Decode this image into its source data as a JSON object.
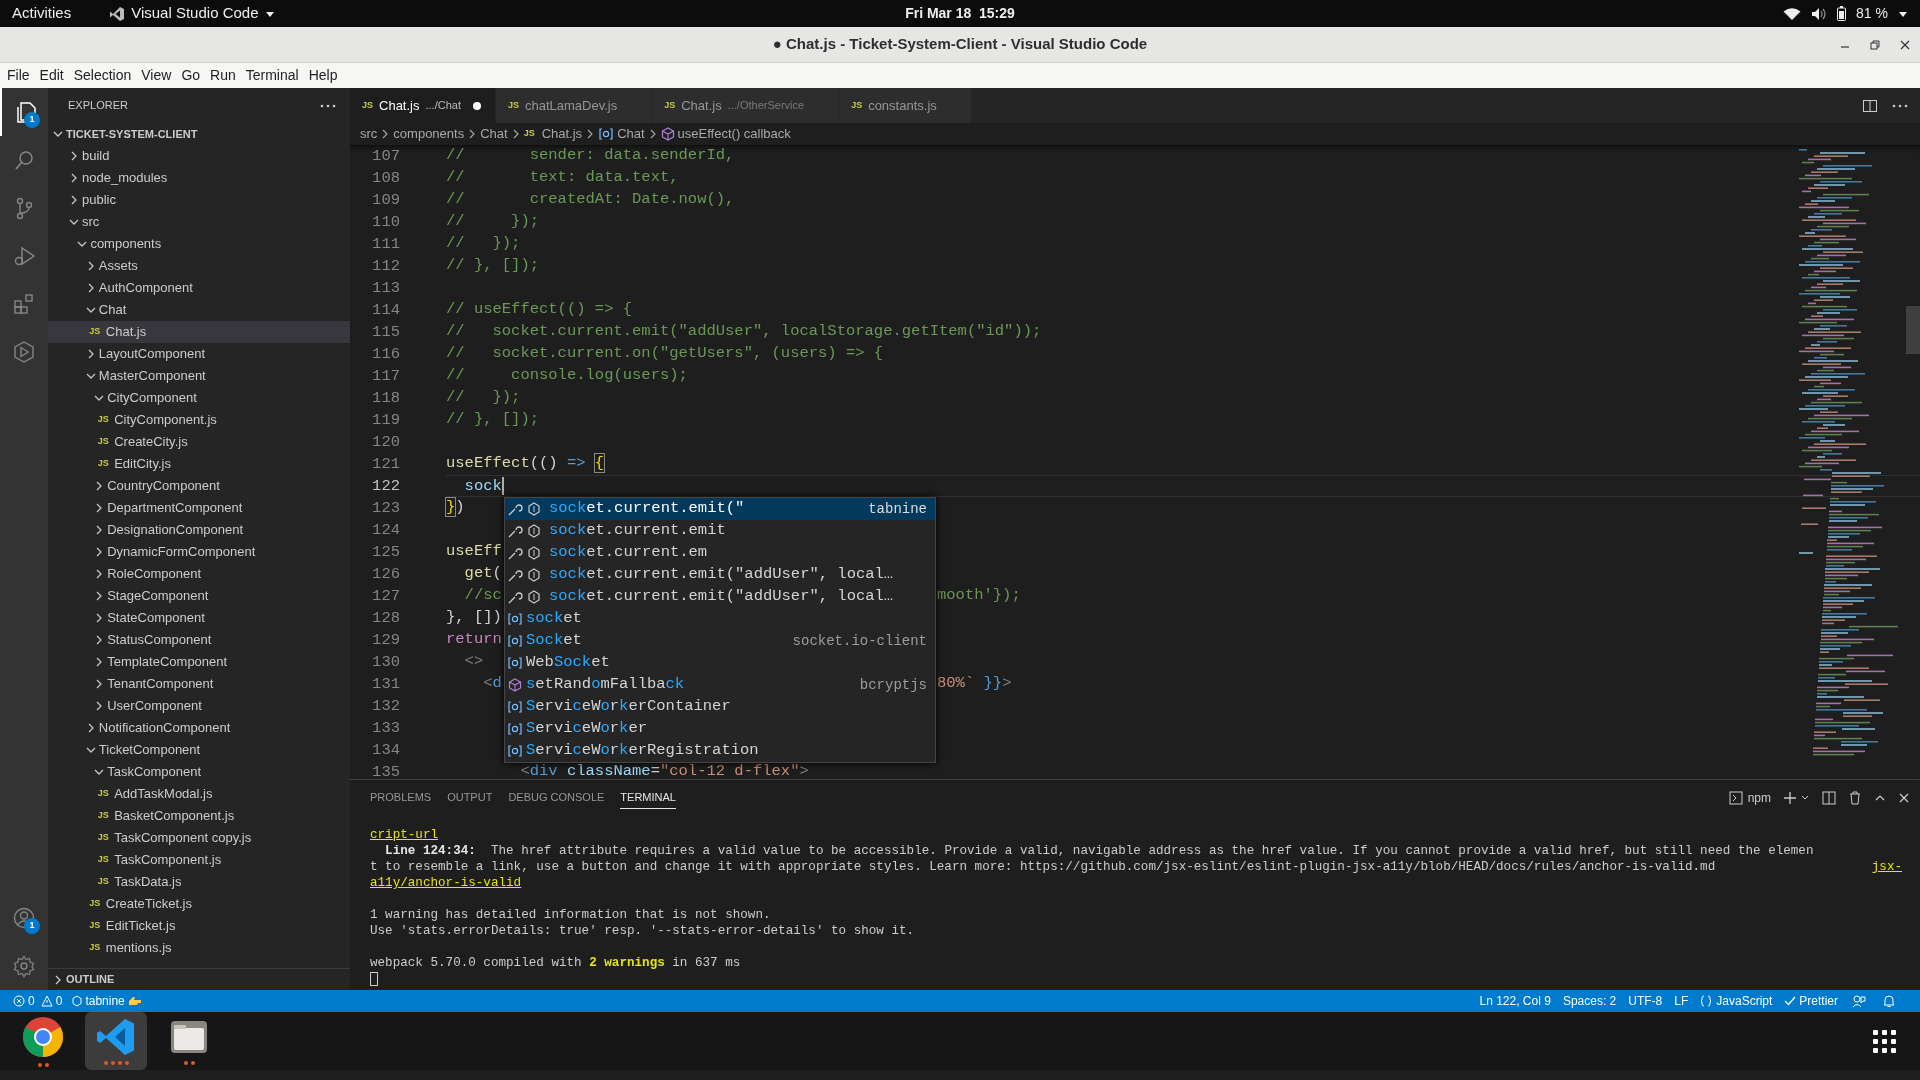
{
  "top_bar": {
    "activities": "Activities",
    "app": "Visual Studio Code",
    "clock": "Fri Mar 18  15:29",
    "battery": "81 %"
  },
  "window": {
    "title": "● Chat.js - Ticket-System-Client - Visual Studio Code"
  },
  "menu": [
    "File",
    "Edit",
    "Selection",
    "View",
    "Go",
    "Run",
    "Terminal",
    "Help"
  ],
  "activity_bar": [
    {
      "kind": "explorer",
      "selected": true,
      "badge": "1"
    },
    {
      "kind": "search",
      "selected": false
    },
    {
      "kind": "source-control",
      "selected": false
    },
    {
      "kind": "run-debug",
      "selected": false
    },
    {
      "kind": "extensions",
      "selected": false
    },
    {
      "kind": "hexagon",
      "selected": false
    }
  ],
  "activity_bottom": [
    {
      "kind": "accounts",
      "badge": "1"
    },
    {
      "kind": "settings"
    }
  ],
  "sidebar": {
    "title": "EXPLORER",
    "section": "TICKET-SYSTEM-CLIENT",
    "outline": "OUTLINE",
    "tree": [
      {
        "label": "build",
        "kind": "folder",
        "expanded": false,
        "selected": false
      },
      {
        "label": "node_modules",
        "kind": "folder",
        "expanded": false,
        "selected": false
      },
      {
        "label": "public",
        "kind": "folder",
        "expanded": false,
        "selected": false
      },
      {
        "label": "src",
        "kind": "folder",
        "expanded": true,
        "selected": false,
        "children": [
          {
            "label": "components",
            "kind": "folder",
            "expanded": true,
            "selected": false,
            "children": [
              {
                "label": "Assets",
                "kind": "folder",
                "expanded": false,
                "selected": false
              },
              {
                "label": "AuthComponent",
                "kind": "folder",
                "expanded": false,
                "selected": false
              },
              {
                "label": "Chat",
                "kind": "folder",
                "expanded": true,
                "selected": false,
                "children": [
                  {
                    "label": "Chat.js",
                    "kind": "file",
                    "badge": "JS",
                    "selected": true
                  }
                ]
              },
              {
                "label": "LayoutComponent",
                "kind": "folder",
                "expanded": false,
                "selected": false
              },
              {
                "label": "MasterComponent",
                "kind": "folder",
                "expanded": true,
                "selected": false,
                "children": [
                  {
                    "label": "CityComponent",
                    "kind": "folder",
                    "expanded": true,
                    "selected": false,
                    "children": [
                      {
                        "label": "CityComponent.js",
                        "kind": "file",
                        "badge": "JS",
                        "selected": false
                      },
                      {
                        "label": "CreateCity.js",
                        "kind": "file",
                        "badge": "JS",
                        "selected": false
                      },
                      {
                        "label": "EditCity.js",
                        "kind": "file",
                        "badge": "JS",
                        "selected": false
                      }
                    ]
                  },
                  {
                    "label": "CountryComponent",
                    "kind": "folder",
                    "expanded": false,
                    "selected": false
                  },
                  {
                    "label": "DepartmentComponent",
                    "kind": "folder",
                    "expanded": false,
                    "selected": false
                  },
                  {
                    "label": "DesignationComponent",
                    "kind": "folder",
                    "expanded": false,
                    "selected": false
                  },
                  {
                    "label": "DynamicFormComponent",
                    "kind": "folder",
                    "expanded": false,
                    "selected": false
                  },
                  {
                    "label": "RoleComponent",
                    "kind": "folder",
                    "expanded": false,
                    "selected": false
                  },
                  {
                    "label": "StageComponent",
                    "kind": "folder",
                    "expanded": false,
                    "selected": false
                  },
                  {
                    "label": "StateComponent",
                    "kind": "folder",
                    "expanded": false,
                    "selected": false
                  },
                  {
                    "label": "StatusComponent",
                    "kind": "folder",
                    "expanded": false,
                    "selected": false
                  },
                  {
                    "label": "TemplateComponent",
                    "kind": "folder",
                    "expanded": false,
                    "selected": false
                  },
                  {
                    "label": "TenantComponent",
                    "kind": "folder",
                    "expanded": false,
                    "selected": false
                  },
                  {
                    "label": "UserComponent",
                    "kind": "folder",
                    "expanded": false,
                    "selected": false
                  }
                ]
              },
              {
                "label": "NotificationComponent",
                "kind": "folder",
                "expanded": false,
                "selected": false
              },
              {
                "label": "TicketComponent",
                "kind": "folder",
                "expanded": true,
                "selected": false,
                "children": [
                  {
                    "label": "TaskComponent",
                    "kind": "folder",
                    "expanded": true,
                    "selected": false,
                    "children": [
                      {
                        "label": "AddTaskModal.js",
                        "kind": "file",
                        "badge": "JS",
                        "selected": false
                      },
                      {
                        "label": "BasketComponent.js",
                        "kind": "file",
                        "badge": "JS",
                        "selected": false
                      },
                      {
                        "label": "TaskComponent copy.js",
                        "kind": "file",
                        "badge": "JS",
                        "selected": false
                      },
                      {
                        "label": "TaskComponent.js",
                        "kind": "file",
                        "badge": "JS",
                        "selected": false
                      },
                      {
                        "label": "TaskData.js",
                        "kind": "file",
                        "badge": "JS",
                        "selected": false
                      }
                    ]
                  },
                  {
                    "label": "CreateTicket.js",
                    "kind": "file",
                    "badge": "JS",
                    "selected": false
                  },
                  {
                    "label": "EditTicket.js",
                    "kind": "file",
                    "badge": "JS",
                    "selected": false
                  },
                  {
                    "label": "mentions.js",
                    "kind": "file",
                    "badge": "JS",
                    "selected": false
                  }
                ]
              }
            ]
          }
        ]
      }
    ]
  },
  "tabs": [
    {
      "badge": "JS",
      "label": "Chat.js",
      "description": ".../Chat",
      "selected": true,
      "dirty": true
    },
    {
      "badge": "JS",
      "label": "chatLamaDev.js",
      "selected": false,
      "dirty": false
    },
    {
      "badge": "JS",
      "label": "Chat.js",
      "description": ".../OtherService",
      "selected": false,
      "dirty": false
    },
    {
      "badge": "JS",
      "label": "constants.js",
      "selected": false,
      "dirty": false
    }
  ],
  "breadcrumbs": [
    {
      "kind": "folder",
      "text": "src"
    },
    {
      "kind": "folder",
      "text": "components"
    },
    {
      "kind": "folder",
      "text": "Chat"
    },
    {
      "kind": "file",
      "badge": "JS",
      "text": "Chat.js"
    },
    {
      "kind": "variable",
      "text": "Chat"
    },
    {
      "kind": "method",
      "text": "useEffect() callback"
    }
  ],
  "code": [
    {
      "number": "107",
      "current": false,
      "tokens": [
        {
          "text": "//       sender: data.senderId,",
          "kind": "comment"
        }
      ]
    },
    {
      "number": "108",
      "current": false,
      "tokens": [
        {
          "text": "//       text: data.text,",
          "kind": "comment"
        }
      ]
    },
    {
      "number": "109",
      "current": false,
      "tokens": [
        {
          "text": "//       createdAt: Date.now(),",
          "kind": "comment"
        }
      ]
    },
    {
      "number": "110",
      "current": false,
      "tokens": [
        {
          "text": "//     });",
          "kind": "comment"
        }
      ]
    },
    {
      "number": "111",
      "current": false,
      "tokens": [
        {
          "text": "//   });",
          "kind": "comment"
        }
      ]
    },
    {
      "number": "112",
      "current": false,
      "tokens": [
        {
          "text": "// }, []);",
          "kind": "comment"
        }
      ]
    },
    {
      "number": "113",
      "current": false
    },
    {
      "number": "114",
      "current": false,
      "tokens": [
        {
          "text": "// useEffect(() => {",
          "kind": "comment"
        }
      ]
    },
    {
      "number": "115",
      "current": false,
      "tokens": [
        {
          "text": "//   socket.current.emit(\"addUser\", localStorage.getItem(\"id\"));",
          "kind": "comment"
        }
      ]
    },
    {
      "number": "116",
      "current": false,
      "tokens": [
        {
          "text": "//   socket.current.on(\"getUsers\", (users) => {",
          "kind": "comment"
        }
      ]
    },
    {
      "number": "117",
      "current": false,
      "tokens": [
        {
          "text": "//     console.log(users);",
          "kind": "comment"
        }
      ]
    },
    {
      "number": "118",
      "current": false,
      "tokens": [
        {
          "text": "//   });",
          "kind": "comment"
        }
      ]
    },
    {
      "number": "119",
      "current": false,
      "tokens": [
        {
          "text": "// }, []);",
          "kind": "comment"
        }
      ]
    },
    {
      "number": "120",
      "current": false
    },
    {
      "number": "121",
      "current": false,
      "tokens": [
        {
          "text": "useEffect",
          "kind": "func"
        },
        {
          "text": "(() ",
          "kind": "punct"
        },
        {
          "text": "=> ",
          "kind": "keyword"
        },
        {
          "text": "{",
          "kind": "bracket-match"
        }
      ]
    },
    {
      "number": "122",
      "current": true,
      "tokens": [
        {
          "text": "  sock",
          "kind": "variable"
        }
      ]
    },
    {
      "number": "123",
      "current": false,
      "tokens": [
        {
          "text": "}",
          "kind": "bracket-match"
        },
        {
          "text": ")",
          "kind": "punct"
        }
      ]
    },
    {
      "number": "124",
      "current": false
    },
    {
      "number": "125",
      "current": false,
      "tokens": [
        {
          "text": "useEff",
          "kind": "func"
        }
      ]
    },
    {
      "number": "126",
      "current": false,
      "tokens": [
        {
          "text": "  get",
          "kind": "func"
        },
        {
          "text": "(",
          "kind": "punct"
        }
      ]
    },
    {
      "number": "127",
      "current": false,
      "tokens": [
        {
          "text": "  //sc",
          "kind": "comment"
        }
      ],
      "beyond_popup": [
        {
          "text": "mooth'});",
          "kind": "comment"
        }
      ]
    },
    {
      "number": "128",
      "current": false,
      "tokens": [
        {
          "text": "}, [])",
          "kind": "punct"
        }
      ]
    },
    {
      "number": "129",
      "current": false,
      "tokens": [
        {
          "text": "return",
          "kind": "control"
        }
      ]
    },
    {
      "number": "130",
      "current": false,
      "tokens": [
        {
          "text": "  <>",
          "kind": "tag-punct"
        }
      ]
    },
    {
      "number": "131",
      "current": false,
      "tokens": [
        {
          "text": "    <",
          "kind": "tag-punct"
        },
        {
          "text": "d",
          "kind": "tag"
        }
      ],
      "beyond_popup": [
        {
          "text": "80%`",
          "kind": "string"
        },
        {
          "text": " }}",
          "kind": "keyword"
        },
        {
          "text": ">",
          "kind": "tag-punct"
        }
      ]
    },
    {
      "number": "132",
      "current": false
    },
    {
      "number": "133",
      "current": false
    },
    {
      "number": "134",
      "current": false
    },
    {
      "number": "135",
      "current": false,
      "tokens": [
        {
          "text": "        <",
          "kind": "tag-punct"
        },
        {
          "text": "div",
          "kind": "tag"
        },
        {
          "text": " className",
          "kind": "attr"
        },
        {
          "text": "=",
          "kind": "punct"
        },
        {
          "text": "\"col-12 d-flex\"",
          "kind": "string"
        },
        {
          "text": ">",
          "kind": "tag-punct"
        }
      ]
    }
  ],
  "suggestions": [
    {
      "kind": "tabnine",
      "selected": true,
      "parts": [
        {
          "text": "sock",
          "match": true
        },
        {
          "text": "et.current.emit(\"",
          "match": false
        }
      ],
      "detail": "tabnine"
    },
    {
      "kind": "tabnine",
      "selected": false,
      "parts": [
        {
          "text": "sock",
          "match": true
        },
        {
          "text": "et.current.emit",
          "match": false
        }
      ]
    },
    {
      "kind": "tabnine",
      "selected": false,
      "parts": [
        {
          "text": "sock",
          "match": true
        },
        {
          "text": "et.current.em",
          "match": false
        }
      ]
    },
    {
      "kind": "tabnine",
      "selected": false,
      "parts": [
        {
          "text": "sock",
          "match": true
        },
        {
          "text": "et.current.emit(\"addUser\", local…",
          "match": false
        }
      ]
    },
    {
      "kind": "tabnine",
      "selected": false,
      "parts": [
        {
          "text": "sock",
          "match": true
        },
        {
          "text": "et.current.emit(\"addUser\", local…",
          "match": false
        }
      ]
    },
    {
      "kind": "variable",
      "selected": false,
      "parts": [
        {
          "text": "sock",
          "match": true
        },
        {
          "text": "et",
          "match": false
        }
      ]
    },
    {
      "kind": "variable",
      "selected": false,
      "parts": [
        {
          "text": "Sock",
          "match": true
        },
        {
          "text": "et",
          "match": false
        }
      ],
      "detail": "socket.io-client"
    },
    {
      "kind": "variable",
      "selected": false,
      "parts": [
        {
          "text": "Web",
          "match": false
        },
        {
          "text": "Sock",
          "match": true
        },
        {
          "text": "et",
          "match": false
        }
      ]
    },
    {
      "kind": "method",
      "selected": false,
      "parts": [
        {
          "text": "s",
          "match": true
        },
        {
          "text": "etRand",
          "match": false
        },
        {
          "text": "o",
          "match": true
        },
        {
          "text": "mFallba",
          "match": false
        },
        {
          "text": "ck",
          "match": true
        }
      ],
      "detail": "bcryptjs"
    },
    {
      "kind": "variable",
      "selected": false,
      "parts": [
        {
          "text": "S",
          "match": true
        },
        {
          "text": "ervi",
          "match": false
        },
        {
          "text": "c",
          "match": true
        },
        {
          "text": "eW",
          "match": false
        },
        {
          "text": "o",
          "match": true
        },
        {
          "text": "r",
          "match": false
        },
        {
          "text": "k",
          "match": true
        },
        {
          "text": "erContainer",
          "match": false
        }
      ]
    },
    {
      "kind": "variable",
      "selected": false,
      "parts": [
        {
          "text": "S",
          "match": true
        },
        {
          "text": "ervi",
          "match": false
        },
        {
          "text": "c",
          "match": true
        },
        {
          "text": "eW",
          "match": false
        },
        {
          "text": "o",
          "match": true
        },
        {
          "text": "r",
          "match": false
        },
        {
          "text": "k",
          "match": true
        },
        {
          "text": "er",
          "match": false
        }
      ]
    },
    {
      "kind": "variable",
      "selected": false,
      "parts": [
        {
          "text": "S",
          "match": true
        },
        {
          "text": "ervi",
          "match": false
        },
        {
          "text": "c",
          "match": true
        },
        {
          "text": "eW",
          "match": false
        },
        {
          "text": "o",
          "match": true
        },
        {
          "text": "r",
          "match": false
        },
        {
          "text": "k",
          "match": true
        },
        {
          "text": "erRegistration",
          "match": false
        }
      ]
    }
  ],
  "panel": {
    "tabs": [
      {
        "label": "PROBLEMS",
        "selected": false
      },
      {
        "label": "OUTPUT",
        "selected": false
      },
      {
        "label": "DEBUG CONSOLE",
        "selected": false
      },
      {
        "label": "TERMINAL",
        "selected": true
      }
    ],
    "terminal_name": "npm",
    "lines": [
      {
        "kind": "text",
        "parts": [
          {
            "text": "cript-url",
            "kind": "link"
          }
        ]
      },
      {
        "kind": "text",
        "parts": [
          {
            "text": "  Line 124:34:",
            "kind": "bold"
          },
          {
            "text": "  The href attribute requires a valid value to be accessible. Provide a valid, navigable address as the href value. If you cannot provide a valid href, but still need the elemen",
            "kind": "plain"
          }
        ]
      },
      {
        "kind": "text",
        "parts": [
          {
            "text": "t to resemble a link, use a button and change it with appropriate styles. Learn more: https://github.com/jsx-eslint/eslint-plugin-jsx-a11y/blob/HEAD/docs/rules/anchor-is-valid.md",
            "kind": "plain"
          },
          {
            "text": "jsx-",
            "kind": "link-right"
          }
        ]
      },
      {
        "kind": "text",
        "parts": [
          {
            "text": "a11y/anchor-is-valid",
            "kind": "link"
          }
        ]
      },
      {
        "kind": "blank"
      },
      {
        "kind": "text",
        "parts": [
          {
            "text": "1 warning has detailed information that is not shown.",
            "kind": "plain"
          }
        ]
      },
      {
        "kind": "text",
        "parts": [
          {
            "text": "Use 'stats.errorDetails: true' resp. '--stats-error-details' to show it.",
            "kind": "plain"
          }
        ]
      },
      {
        "kind": "blank"
      },
      {
        "kind": "text",
        "parts": [
          {
            "text": "webpack 5.70.0 compiled with ",
            "kind": "plain"
          },
          {
            "text": "2 warnings",
            "kind": "warn"
          },
          {
            "text": " in 637 ms",
            "kind": "plain"
          }
        ]
      },
      {
        "kind": "cursor"
      }
    ]
  },
  "status_bar": {
    "left": [
      {
        "kind": "problems",
        "errors": "0",
        "warnings": "0"
      },
      {
        "kind": "tabnine",
        "text": "tabnine"
      }
    ],
    "right": [
      {
        "kind": "text",
        "text": "Ln 122, Col 9"
      },
      {
        "kind": "text",
        "text": "Spaces: 2"
      },
      {
        "kind": "text",
        "text": "UTF-8"
      },
      {
        "kind": "text",
        "text": "LF"
      },
      {
        "kind": "language",
        "text": "JavaScript"
      },
      {
        "kind": "prettier",
        "text": "Prettier"
      },
      {
        "kind": "feedback"
      },
      {
        "kind": "bell"
      }
    ]
  },
  "dock": [
    {
      "kind": "browser",
      "selected": false,
      "running": true
    },
    {
      "kind": "editor",
      "selected": true,
      "running": true
    },
    {
      "kind": "files",
      "selected": false,
      "running": true
    }
  ]
}
